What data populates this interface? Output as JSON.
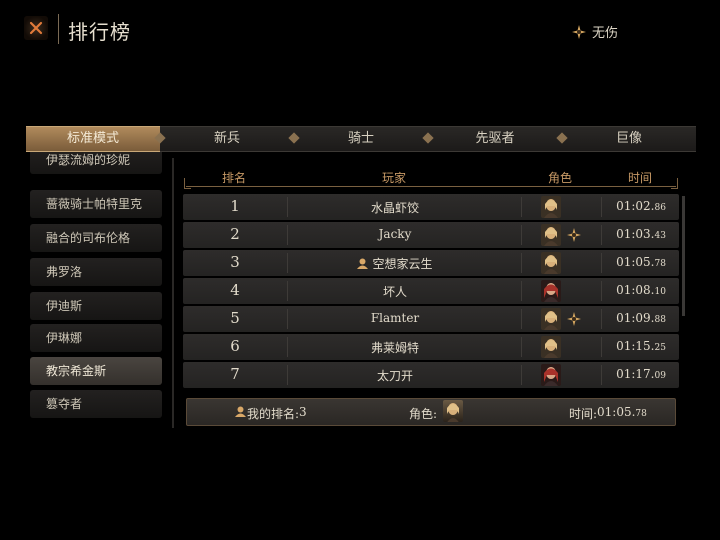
{
  "header": {
    "title": "排行榜",
    "status_label": "无伤"
  },
  "tabs": [
    {
      "label": "标准模式",
      "active": true
    },
    {
      "label": "新兵"
    },
    {
      "label": "骑士"
    },
    {
      "label": "先驱者"
    },
    {
      "label": "巨像"
    }
  ],
  "sidebar": {
    "items": [
      {
        "label": "伊瑟流姆的珍妮"
      },
      {
        "label": "蔷薇骑士帕特里克"
      },
      {
        "label": "融合的司布伦格"
      },
      {
        "label": "弗罗洛"
      },
      {
        "label": "伊迪斯"
      },
      {
        "label": "伊琳娜"
      },
      {
        "label": "教宗希金斯",
        "active": true
      },
      {
        "label": "篡夺者"
      }
    ]
  },
  "table": {
    "headers": {
      "rank": "排名",
      "player": "玩家",
      "role": "角色",
      "time": "时间"
    },
    "rows": [
      {
        "rank": "1",
        "player": "水晶虾饺",
        "portrait": "blonde-character",
        "badge": false,
        "user_icon": false,
        "time_main": "01:02.",
        "time_ms": "86"
      },
      {
        "rank": "2",
        "player": "Jacky",
        "portrait": "blonde-character",
        "badge": true,
        "user_icon": false,
        "time_main": "01:03.",
        "time_ms": "43"
      },
      {
        "rank": "3",
        "player": "空想家云生",
        "portrait": "blonde-character",
        "badge": false,
        "user_icon": true,
        "time_main": "01:05.",
        "time_ms": "78"
      },
      {
        "rank": "4",
        "player": "坏人",
        "portrait": "redhair-character",
        "badge": false,
        "user_icon": false,
        "time_main": "01:08.",
        "time_ms": "10"
      },
      {
        "rank": "5",
        "player": "Flamter",
        "portrait": "blonde-character",
        "badge": true,
        "user_icon": false,
        "time_main": "01:09.",
        "time_ms": "88"
      },
      {
        "rank": "6",
        "player": "弗莱姆特",
        "portrait": "blonde-character",
        "badge": false,
        "user_icon": false,
        "time_main": "01:15.",
        "time_ms": "25"
      },
      {
        "rank": "7",
        "player": "太刀开",
        "portrait": "redhair-character",
        "badge": false,
        "user_icon": false,
        "time_main": "01:17.",
        "time_ms": "09"
      }
    ]
  },
  "my_rank": {
    "label": "我的排名:",
    "value": "3",
    "role_label": "角色:",
    "time_label": "时间:",
    "time_main": "01:05.",
    "time_ms": "78"
  },
  "colors": {
    "accent_gold": "#c89a66",
    "badge_gold": "#d4a660",
    "active_tab": "#a8845a"
  }
}
